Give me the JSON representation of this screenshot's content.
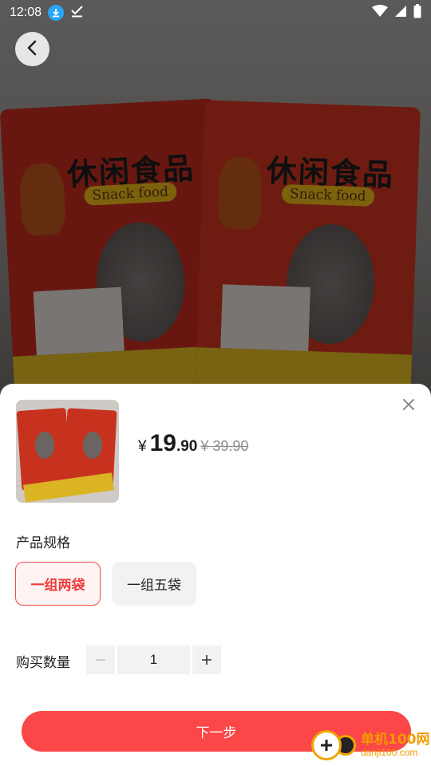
{
  "status_bar": {
    "time": "12:08"
  },
  "product_photo": {
    "brand_text": "休闲食品",
    "brand_subtitle": "Snack food"
  },
  "sheet": {
    "price": {
      "currency": "¥",
      "integer": "19",
      "decimal": ".90",
      "original": "¥ 39.90"
    },
    "spec_title": "产品规格",
    "options": [
      {
        "label": "一组两袋",
        "selected": true
      },
      {
        "label": "一组五袋",
        "selected": false
      }
    ],
    "quantity_title": "购买数量",
    "quantity": "1",
    "next_button": "下一步"
  },
  "watermark": {
    "name": "单机100网",
    "url": "danji100.com"
  },
  "colors": {
    "accent": "#fb4748",
    "selected_border": "#f04a4a",
    "watermark": "#f29a00"
  }
}
